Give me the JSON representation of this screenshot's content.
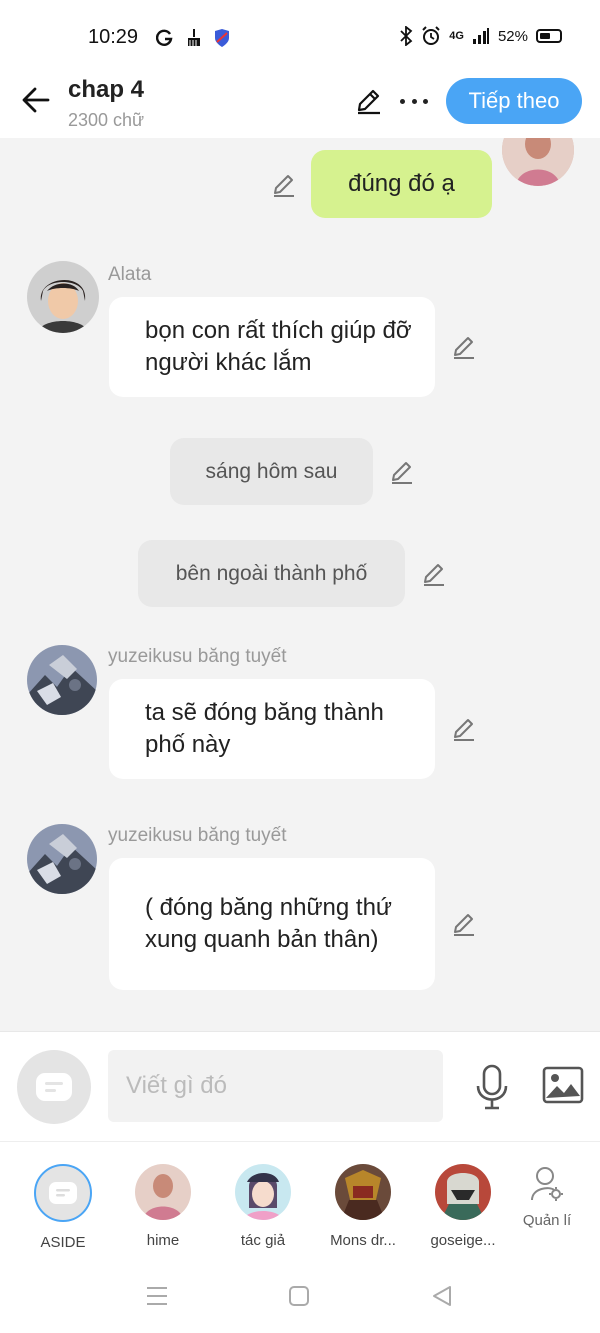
{
  "status_bar": {
    "time": "10:29",
    "network": "4G",
    "battery": "52%"
  },
  "header": {
    "title": "chap 4",
    "subtitle": "2300 chữ",
    "next_label": "Tiếp theo"
  },
  "messages": [
    {
      "type": "self",
      "text": "đúng đó ạ"
    },
    {
      "type": "character",
      "sender": "Alata",
      "text": "bọn con rất thích giúp đỡ người khác lắm"
    },
    {
      "type": "narration",
      "text": "sáng hôm sau"
    },
    {
      "type": "narration",
      "text": "bên ngoài thành phố"
    },
    {
      "type": "character",
      "sender": "yuzeikusu băng tuyết",
      "text": "ta sẽ đóng băng thành phố này"
    },
    {
      "type": "character",
      "sender": "yuzeikusu băng tuyết",
      "text": "( đóng băng những thứ xung quanh bản thân)"
    }
  ],
  "input": {
    "placeholder": "Viết gì đó"
  },
  "characters": [
    {
      "name": "ASIDE"
    },
    {
      "name": "hime"
    },
    {
      "name": "tác giả"
    },
    {
      "name": "Mons dr..."
    },
    {
      "name": "goseige..."
    },
    {
      "name": "Quản lí"
    }
  ],
  "colors": {
    "accent": "#4aa5f5",
    "self_bubble": "#d6f28f",
    "background": "#f3f3f3"
  }
}
